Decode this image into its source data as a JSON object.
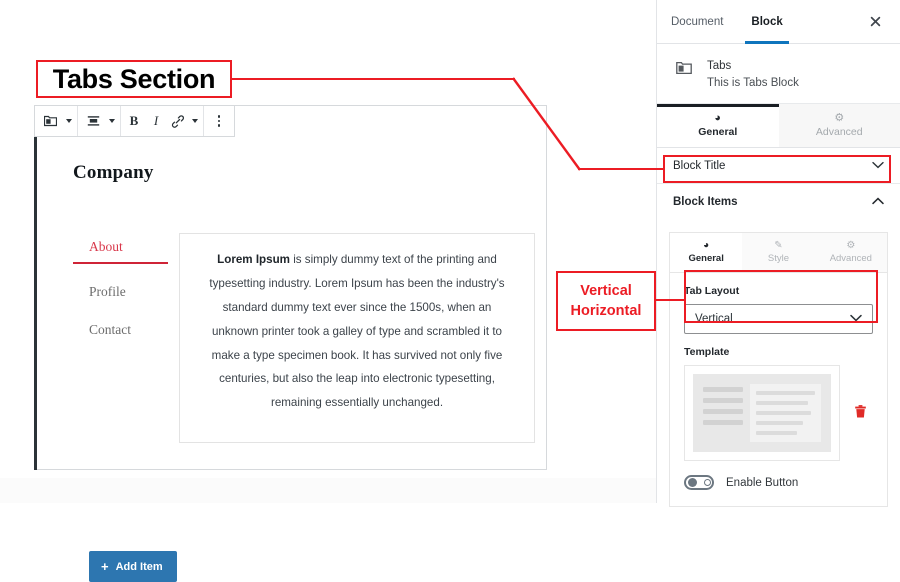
{
  "annotations": {
    "tabs_section_label": "Tabs Section",
    "vertical_label": "Vertical",
    "horizontal_label": "Horizontal",
    "accent_color": "#ec1c24"
  },
  "editor": {
    "toolbar": {
      "block_type_icon": "block-type-icon",
      "block_type_caret": "chevron-down-icon",
      "align_icon": "align-icon",
      "align_caret": "chevron-down-icon",
      "bold_label": "B",
      "italic_label": "I",
      "link_icon": "link-icon",
      "more_formats_caret": "chevron-down-icon",
      "options_icon": "more-vertical-icon"
    },
    "block": {
      "heading": "Company",
      "tabs": [
        {
          "label": "About",
          "active": true
        },
        {
          "label": "Profile",
          "active": false
        },
        {
          "label": "Contact",
          "active": false
        }
      ],
      "panel_lead": "Lorem Ipsum",
      "panel_text": " is simply dummy text of the printing and typesetting industry. Lorem Ipsum has been the industry's standard dummy text ever since the 1500s, when an unknown printer took a galley of type and scrambled it to make a type specimen book. It has survived not only five centuries, but also the leap into electronic typesetting, remaining essentially unchanged.",
      "add_item_label": "Add Item",
      "add_item_icon": "plus-icon",
      "add_item_color": "#2d76b0"
    }
  },
  "sidebar": {
    "tabs": [
      {
        "label": "Document",
        "active": false
      },
      {
        "label": "Block",
        "active": true
      }
    ],
    "close_icon": "close-icon",
    "block_info": {
      "icon": "tabs-block-icon",
      "title": "Tabs",
      "description": "This is Tabs Block"
    },
    "primary_tabs": [
      {
        "label": "General",
        "icon": "dashboard-icon",
        "active": true
      },
      {
        "label": "Advanced",
        "icon": "gear-icon",
        "active": false
      }
    ],
    "block_title_row": {
      "label": "Block Title",
      "chevron": "chevron-down-icon"
    },
    "block_items_row": {
      "label": "Block Items",
      "chevron": "chevron-up-icon"
    },
    "item_tabs": [
      {
        "label": "General",
        "icon": "dashboard-icon",
        "active": true
      },
      {
        "label": "Style",
        "icon": "pencil-icon",
        "active": false
      },
      {
        "label": "Advanced",
        "icon": "gear-icon",
        "active": false
      }
    ],
    "tab_layout": {
      "label": "Tab Layout",
      "value": "Vertical",
      "options": [
        "Vertical",
        "Horizontal"
      ],
      "chevron": "chevron-down-icon"
    },
    "template": {
      "label": "Template",
      "delete_icon": "trash-icon",
      "delete_color": "#e02b27"
    },
    "enable_button": {
      "label": "Enable Button",
      "state": "off",
      "toggle_icon": "toggle-off-icon"
    }
  }
}
